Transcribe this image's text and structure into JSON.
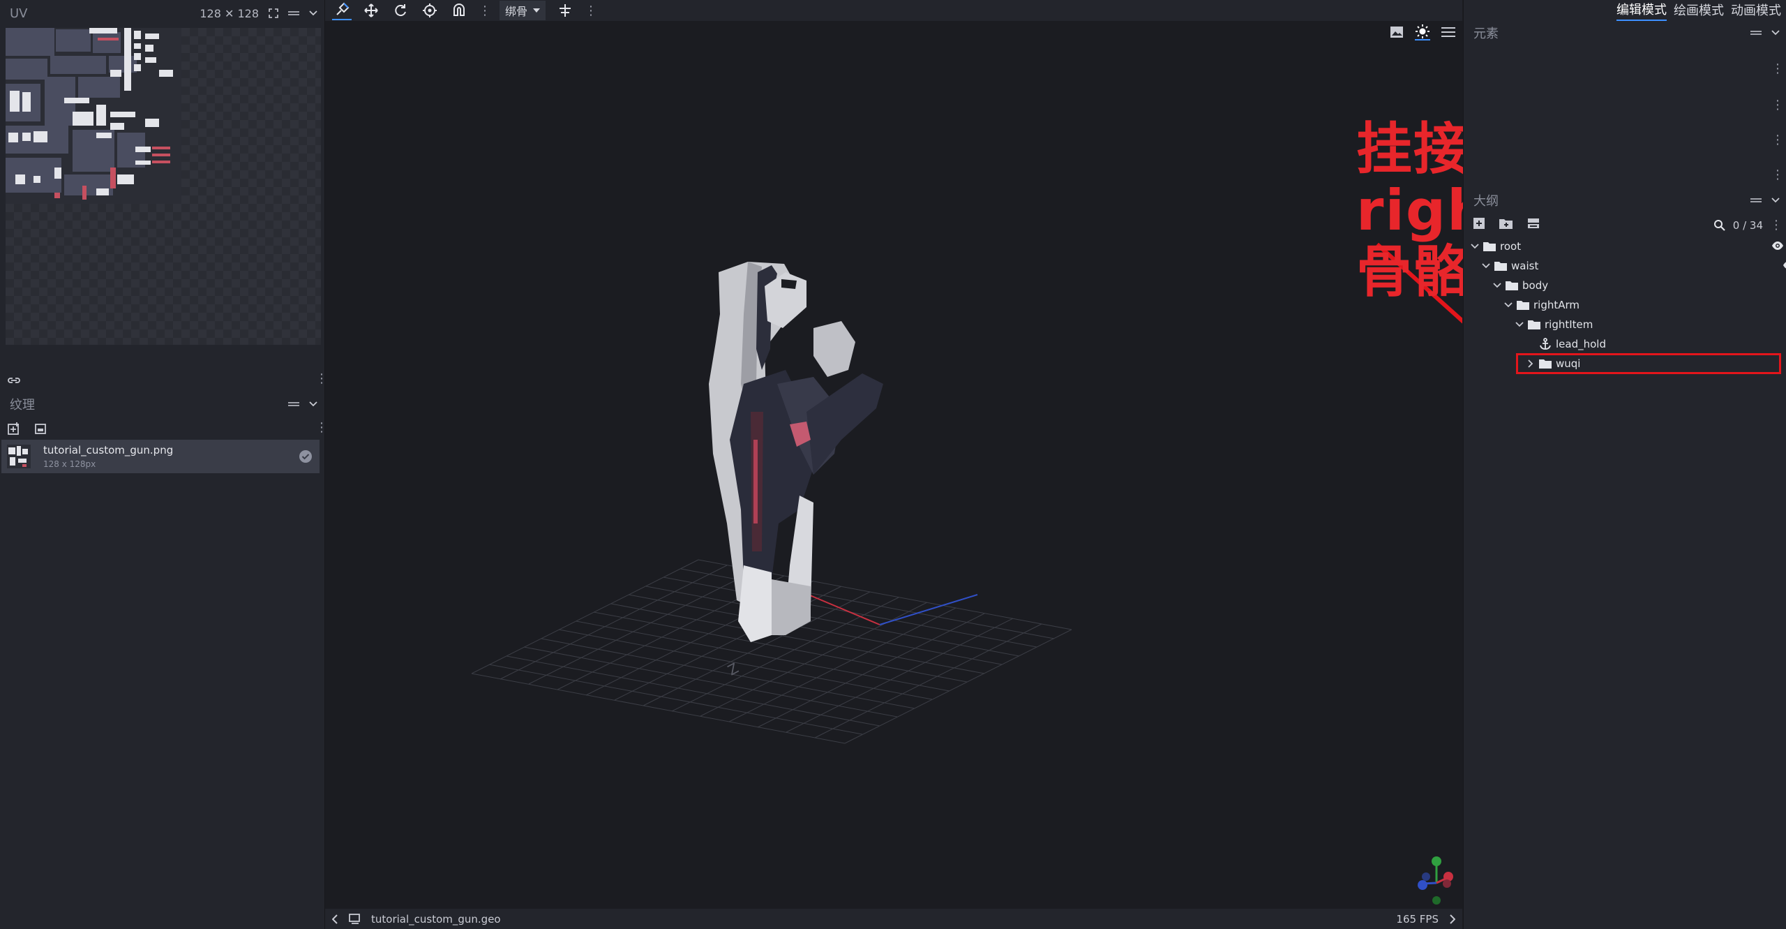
{
  "left_panel": {
    "uv_title": "UV",
    "uv_size": "128 ✕ 128",
    "textures_title": "纹理",
    "texture": {
      "name": "tutorial_custom_gun.png",
      "dimensions": "128 x 128px"
    }
  },
  "toolbar": {
    "pivot_select": "绑骨"
  },
  "modes": [
    "编辑模式",
    "绘画模式",
    "动画模式"
  ],
  "active_mode": "编辑模式",
  "elements_panel": {
    "title": "元素"
  },
  "outliner": {
    "title": "大纲",
    "count": "0 / 34",
    "tree": [
      {
        "label": "root",
        "depth": 0,
        "expanded": true,
        "type": "folder"
      },
      {
        "label": "waist",
        "depth": 1,
        "expanded": true,
        "type": "folder"
      },
      {
        "label": "body",
        "depth": 2,
        "expanded": true,
        "type": "folder"
      },
      {
        "label": "rightArm",
        "depth": 3,
        "expanded": true,
        "type": "folder"
      },
      {
        "label": "rightItem",
        "depth": 4,
        "expanded": true,
        "type": "folder"
      },
      {
        "label": "lead_hold",
        "depth": 5,
        "expanded": false,
        "type": "locator"
      },
      {
        "label": "wuqi",
        "depth": 5,
        "expanded": false,
        "type": "folder",
        "highlighted": true
      }
    ]
  },
  "viewport": {
    "annotation_lines": [
      "挂接在原版的",
      "rightltem",
      "骨骼组下"
    ]
  },
  "statusbar": {
    "model_name": "tutorial_custom_gun.geo",
    "fps": "165 FPS"
  },
  "colors": {
    "accent": "#3e90ff",
    "annotation": "#e8262b",
    "highlight": "#e3151b"
  },
  "icons": [
    "search-icon",
    "eye-icon",
    "folder-icon",
    "chevron-down-icon",
    "chevron-right-icon",
    "anchor-icon"
  ]
}
